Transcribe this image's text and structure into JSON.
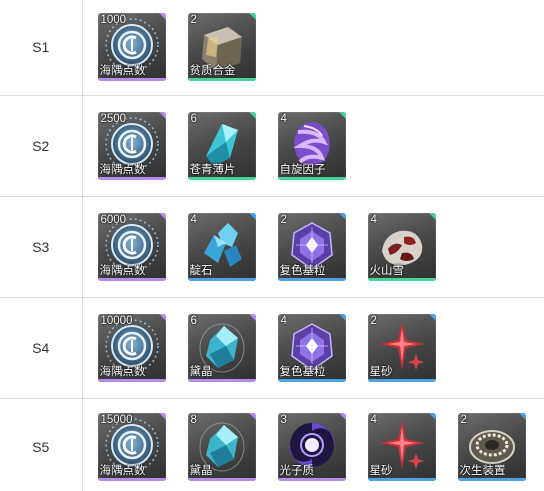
{
  "rarity_colors": {
    "purple": "#b48cf0",
    "blue": "#4aa3e8",
    "green": "#46d39a"
  },
  "rows": [
    {
      "stage": "S1",
      "items": [
        {
          "count": "1000",
          "name": "海隅点数",
          "icon": "sea-corner-points-icon",
          "rarity": "purple"
        },
        {
          "count": "2",
          "name": "贫质合金",
          "icon": "poor-alloy-icon",
          "rarity": "green"
        }
      ]
    },
    {
      "stage": "S2",
      "items": [
        {
          "count": "2500",
          "name": "海隅点数",
          "icon": "sea-corner-points-icon",
          "rarity": "purple"
        },
        {
          "count": "6",
          "name": "苍青薄片",
          "icon": "cyan-flake-icon",
          "rarity": "green"
        },
        {
          "count": "4",
          "name": "自旋因子",
          "icon": "spin-factor-icon",
          "rarity": "green"
        }
      ]
    },
    {
      "stage": "S3",
      "items": [
        {
          "count": "6000",
          "name": "海隅点数",
          "icon": "sea-corner-points-icon",
          "rarity": "purple"
        },
        {
          "count": "4",
          "name": "靛石",
          "icon": "indigo-stone-icon",
          "rarity": "blue"
        },
        {
          "count": "2",
          "name": "复色基粒",
          "icon": "multicolor-granule-icon",
          "rarity": "blue"
        },
        {
          "count": "4",
          "name": "火山雪",
          "icon": "volcanic-snow-icon",
          "rarity": "green"
        }
      ]
    },
    {
      "stage": "S4",
      "items": [
        {
          "count": "10000",
          "name": "海隅点数",
          "icon": "sea-corner-points-icon",
          "rarity": "purple"
        },
        {
          "count": "6",
          "name": "黛晶",
          "icon": "dark-crystal-icon",
          "rarity": "purple"
        },
        {
          "count": "4",
          "name": "复色基粒",
          "icon": "multicolor-granule-icon",
          "rarity": "blue"
        },
        {
          "count": "2",
          "name": "星砂",
          "icon": "star-sand-icon",
          "rarity": "blue"
        }
      ]
    },
    {
      "stage": "S5",
      "items": [
        {
          "count": "15000",
          "name": "海隅点数",
          "icon": "sea-corner-points-icon",
          "rarity": "purple"
        },
        {
          "count": "8",
          "name": "黛晶",
          "icon": "dark-crystal-icon",
          "rarity": "purple"
        },
        {
          "count": "3",
          "name": "光子质",
          "icon": "photon-mass-icon",
          "rarity": "purple"
        },
        {
          "count": "4",
          "name": "星砂",
          "icon": "star-sand-icon",
          "rarity": "blue"
        },
        {
          "count": "2",
          "name": "次生装置",
          "icon": "secondary-device-icon",
          "rarity": "blue"
        }
      ]
    }
  ]
}
